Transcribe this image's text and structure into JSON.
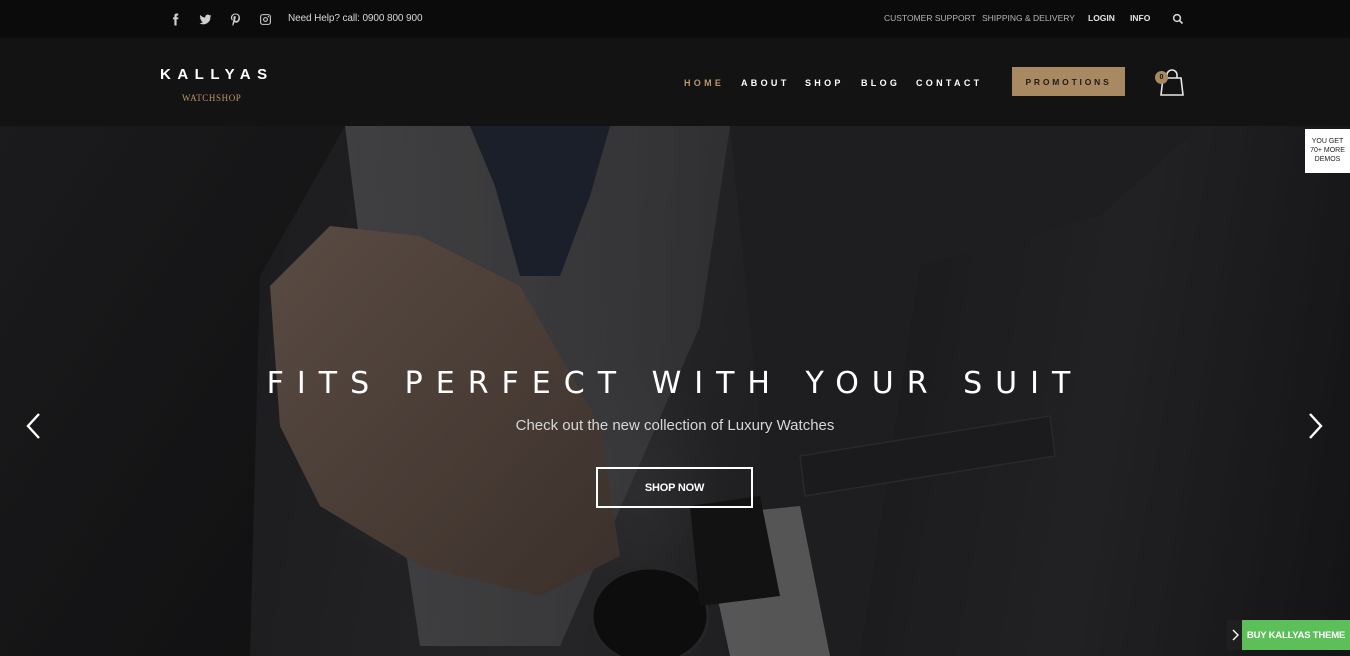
{
  "topbar": {
    "social": [
      {
        "name": "facebook-icon"
      },
      {
        "name": "twitter-icon"
      },
      {
        "name": "pinterest-icon"
      },
      {
        "name": "instagram-icon"
      }
    ],
    "help_text": "Need Help? call: 0900 800 900",
    "links": {
      "support": "CUSTOMER SUPPORT",
      "shipping": "SHIPPING & DELIVERY",
      "login": "LOGIN",
      "info": "INFO"
    }
  },
  "header": {
    "logo_title": "KALLYAS",
    "logo_sub": "WATCHSHOP",
    "nav": {
      "home": "HOME",
      "about": "ABOUT",
      "shop": "SHOP",
      "blog": "BLOG",
      "contact": "CONTACT"
    },
    "promo_label": "PROMOTIONS",
    "cart_count": "0"
  },
  "hero": {
    "title": "FITS PERFECT WITH YOUR SUIT",
    "subtitle": "Check out the new collection of Luxury Watches",
    "button_label": "SHOP NOW"
  },
  "side": {
    "demos_line1": "YOU GET",
    "demos_line2": "70+ MORE",
    "demos_line3": "DEMOS",
    "buy_label": "BUY KALLYAS THEME"
  },
  "colors": {
    "accent": "#b9976a",
    "promo_bg": "#a88962",
    "buy_bg": "#5cbf5a"
  }
}
